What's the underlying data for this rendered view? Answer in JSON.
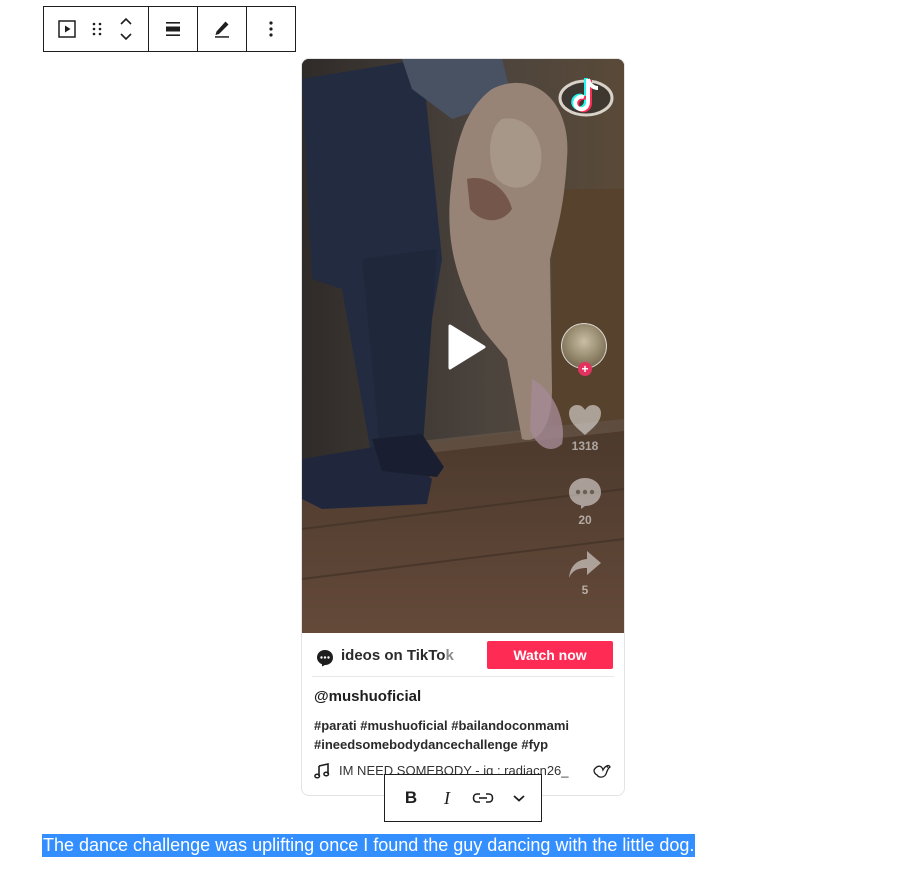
{
  "block_toolbar": {
    "buttons": [
      {
        "icon": "embed-video-icon"
      },
      {
        "icon": "drag-handle-icon"
      },
      {
        "icon": "move-up-icon"
      },
      {
        "icon": "move-down-icon"
      },
      {
        "icon": "align-icon"
      },
      {
        "icon": "edit-url-icon"
      },
      {
        "icon": "more-options-icon"
      }
    ]
  },
  "tiktok": {
    "stats": {
      "likes": "1318",
      "comments": "20",
      "shares": "5"
    },
    "more_videos_text": "ideos on TikTok",
    "more_videos_text_fade": "k",
    "watch_now_label": "Watch now",
    "author": "@mushuoficial",
    "caption": "#parati #mushuoficial #bailandoconmami #ineedsomebodydancechallenge #fyp",
    "music": "IM NEED SOMEBODY - ig : radiacn26_",
    "colors": {
      "watch_button": "#fe2c55",
      "follow_badge": "#e3325d"
    }
  },
  "format_toolbar": {
    "bold_label": "B",
    "italic_label": "I",
    "buttons": [
      {
        "icon": "bold-icon"
      },
      {
        "icon": "italic-icon"
      },
      {
        "icon": "link-icon"
      },
      {
        "icon": "chevron-down-icon"
      }
    ]
  },
  "paragraph": {
    "text": "The dance challenge was uplifting once I found the guy dancing with the little dog.",
    "selection_color": "#338fff"
  }
}
